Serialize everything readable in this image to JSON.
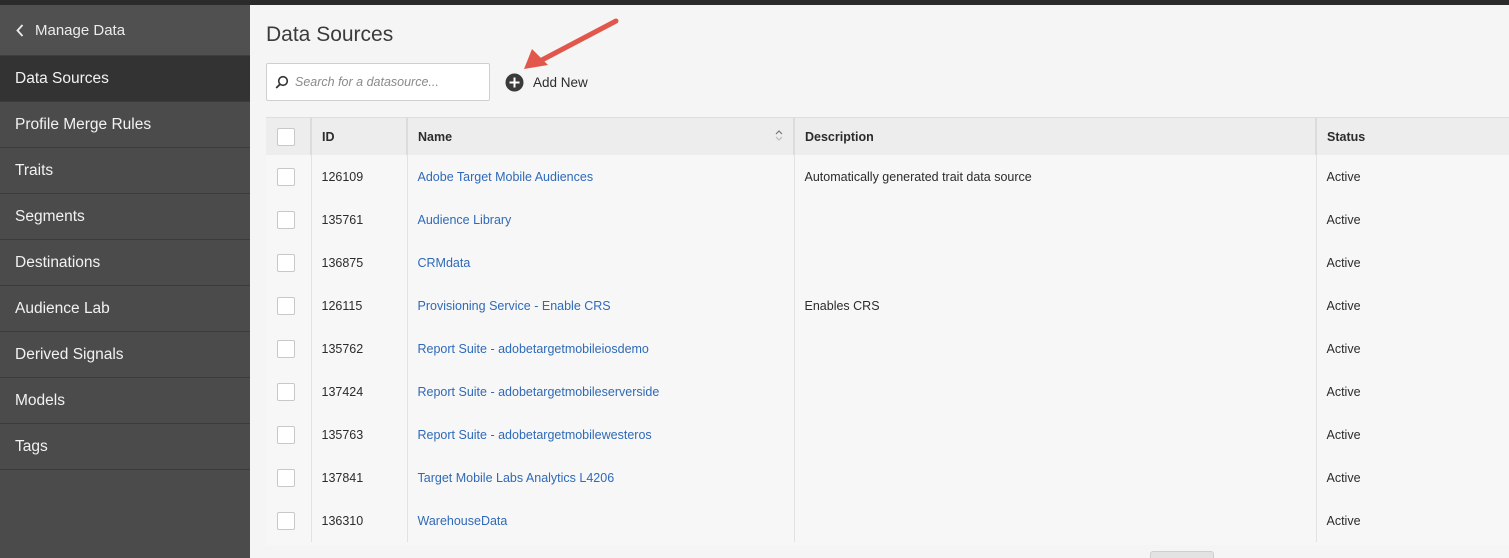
{
  "sidebar": {
    "back_label": "Manage Data",
    "items": [
      {
        "label": "Data Sources",
        "active": true
      },
      {
        "label": "Profile Merge Rules",
        "active": false
      },
      {
        "label": "Traits",
        "active": false
      },
      {
        "label": "Segments",
        "active": false
      },
      {
        "label": "Destinations",
        "active": false
      },
      {
        "label": "Audience Lab",
        "active": false
      },
      {
        "label": "Derived Signals",
        "active": false
      },
      {
        "label": "Models",
        "active": false
      },
      {
        "label": "Tags",
        "active": false
      }
    ]
  },
  "main": {
    "title": "Data Sources",
    "search": {
      "placeholder": "Search for a datasource...",
      "value": ""
    },
    "add_new_label": "Add New"
  },
  "table": {
    "columns": {
      "id": "ID",
      "name": "Name",
      "description": "Description",
      "status": "Status"
    },
    "rows": [
      {
        "id": "126109",
        "name": "Adobe Target Mobile Audiences",
        "description": "Automatically generated trait data source",
        "status": "Active"
      },
      {
        "id": "135761",
        "name": "Audience Library",
        "description": "",
        "status": "Active"
      },
      {
        "id": "136875",
        "name": "CRMdata",
        "description": "",
        "status": "Active"
      },
      {
        "id": "126115",
        "name": "Provisioning Service - Enable CRS",
        "description": "Enables CRS",
        "status": "Active"
      },
      {
        "id": "135762",
        "name": "Report Suite - adobetargetmobileiosdemo",
        "description": "",
        "status": "Active"
      },
      {
        "id": "137424",
        "name": "Report Suite - adobetargetmobileserverside",
        "description": "",
        "status": "Active"
      },
      {
        "id": "135763",
        "name": "Report Suite - adobetargetmobilewesteros",
        "description": "",
        "status": "Active"
      },
      {
        "id": "137841",
        "name": "Target Mobile Labs Analytics L4206",
        "description": "",
        "status": "Active"
      },
      {
        "id": "136310",
        "name": "WarehouseData",
        "description": "",
        "status": "Active"
      }
    ]
  },
  "colors": {
    "sidebar_bg": "#4b4b4b",
    "sidebar_active": "#333333",
    "link": "#2f6ab8",
    "annotation_arrow": "#e2574c"
  },
  "icons": {
    "back": "chevron-left-icon",
    "search": "search-icon",
    "add": "plus-circle-icon",
    "sort": "sort-icon",
    "annotation": "arrow-icon"
  }
}
